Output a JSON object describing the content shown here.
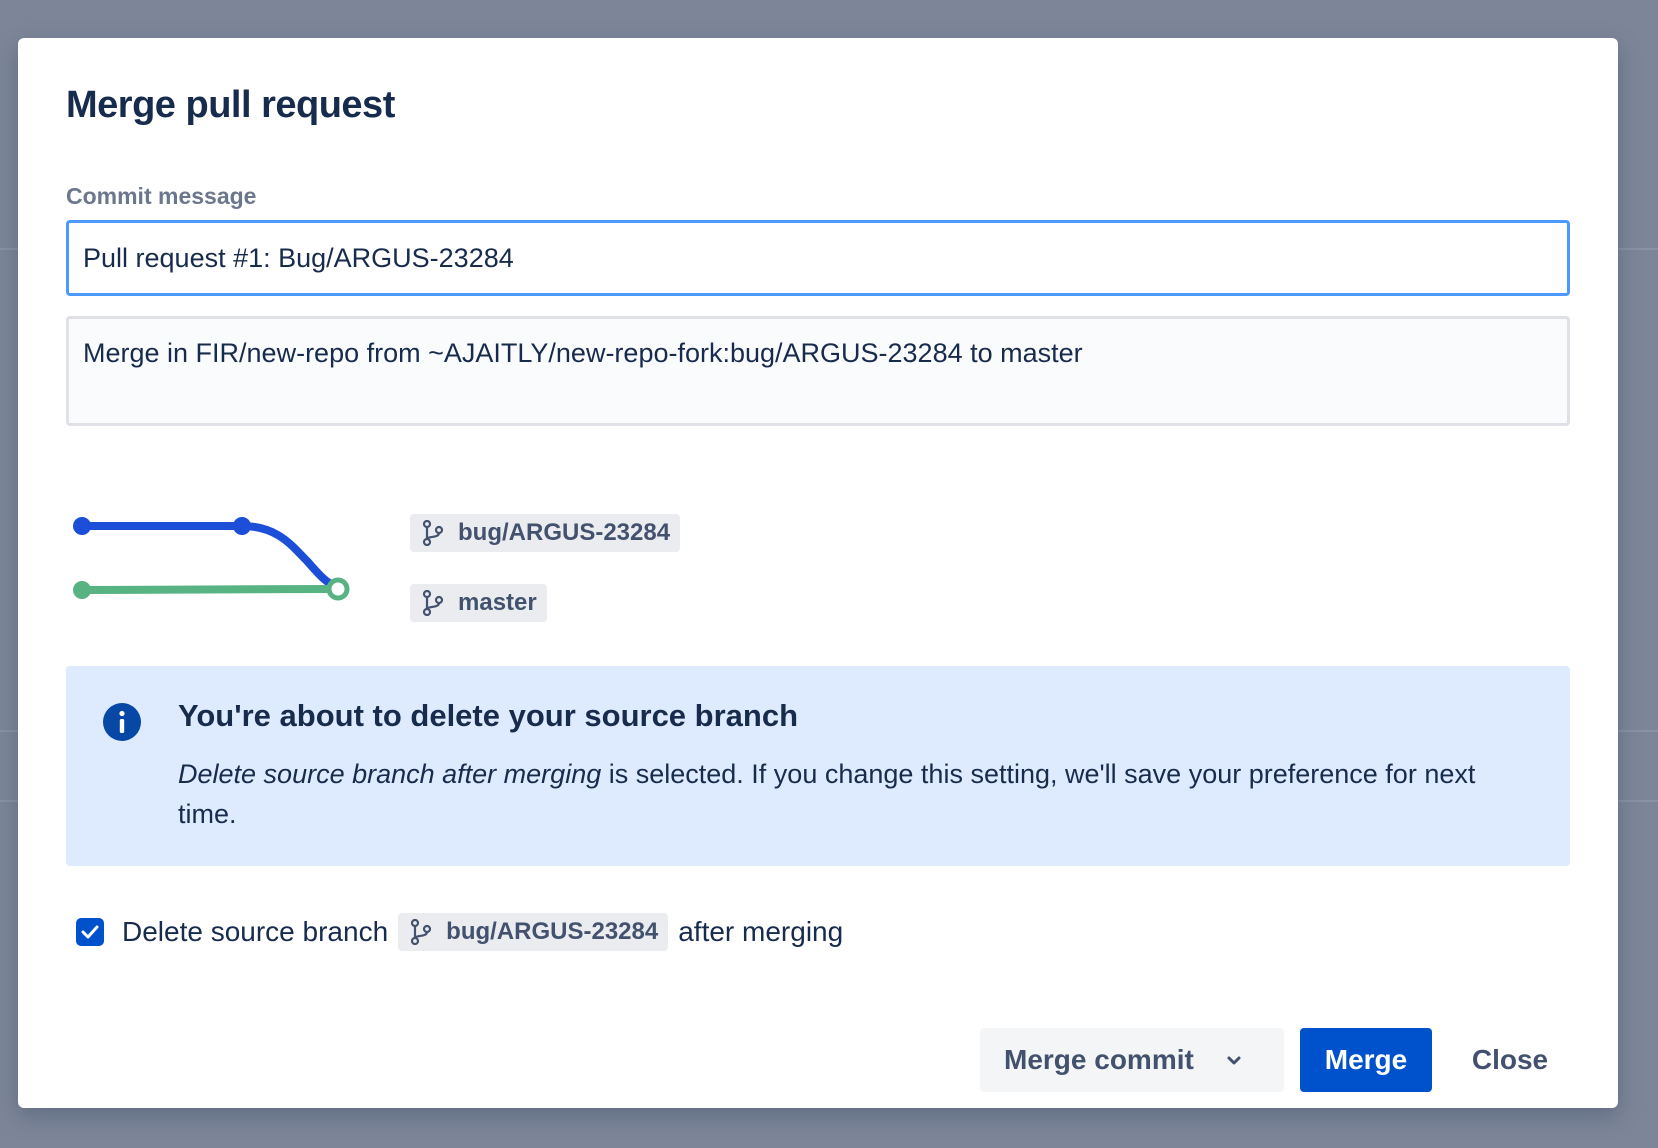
{
  "dialog": {
    "title": "Merge pull request",
    "commit_message_label": "Commit message",
    "commit_subject": "Pull request #1: Bug/ARGUS-23284",
    "commit_body": "Merge in FIR/new-repo from ~AJAITLY/new-repo-fork:bug/ARGUS-23284 to master"
  },
  "branches": {
    "source": "bug/ARGUS-23284",
    "target": "master",
    "icon": "branch-icon",
    "graph_colors": {
      "source": "#1d4ed8",
      "target": "#57b382"
    }
  },
  "info_panel": {
    "icon": "info-icon",
    "heading": "You're about to delete your source branch",
    "body_emphasis": "Delete source branch after merging",
    "body_rest": " is selected. If you change this setting, we'll save your preference for next time.",
    "background": "#deebff"
  },
  "delete_option": {
    "checked": true,
    "label_before": "Delete source branch",
    "branch": "bug/ARGUS-23284",
    "label_after": "after merging"
  },
  "footer": {
    "strategy_label": "Merge commit",
    "merge_label": "Merge",
    "close_label": "Close",
    "primary_color": "#0052cc"
  }
}
